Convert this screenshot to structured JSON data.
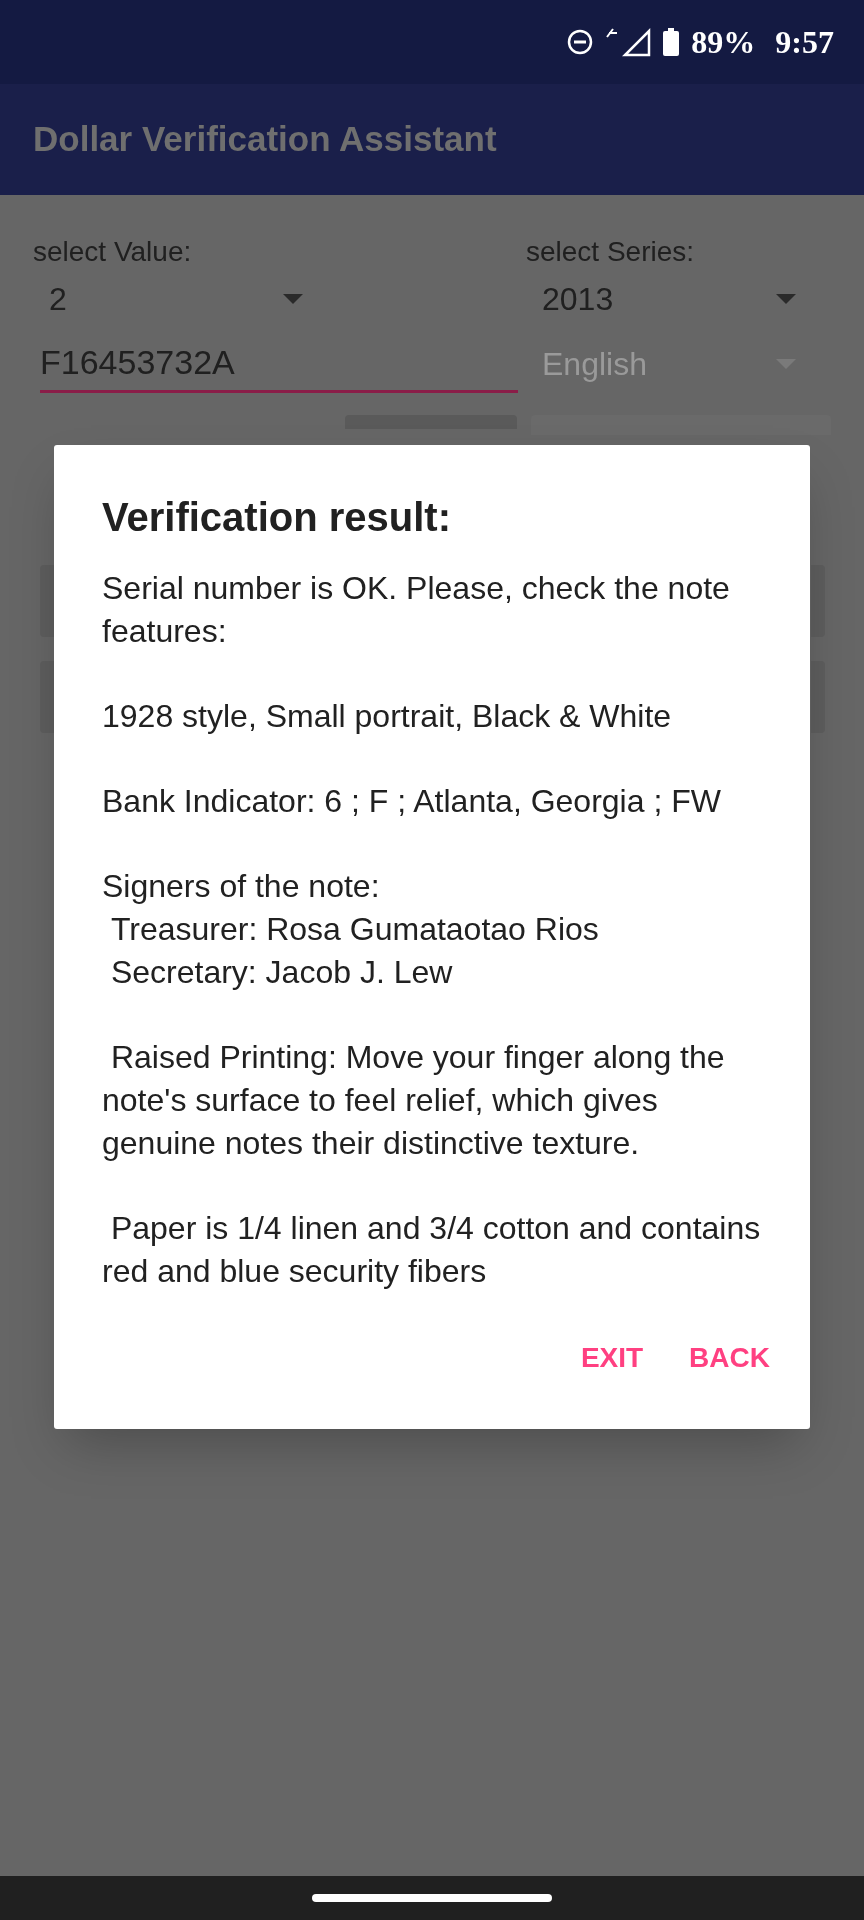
{
  "status_bar": {
    "battery": "89%",
    "time": "9:57"
  },
  "app_bar": {
    "title": "Dollar Verification Assistant"
  },
  "form": {
    "value_label": "select Value:",
    "value": "2",
    "series_label": "select Series:",
    "series": "2013",
    "serial": "F16453732A",
    "language": "English",
    "language_disabled": true
  },
  "dialog": {
    "title": "Verification result:",
    "paragraphs": [
      "Serial number is OK. Please, check the note features:",
      "1928 style, Small portrait, Black & White",
      "Bank Indicator: 6 ; F ; Atlanta, Georgia ; FW",
      "Signers of the note:\n Treasurer: Rosa Gumataotao Rios\n Secretary: Jacob J. Lew",
      " Raised Printing: Move your finger along the note's surface to feel relief, which gives genuine notes their distinctive texture.",
      " Paper is 1/4 linen and 3/4 cotton and contains red and blue security fibers"
    ],
    "buttons": [
      "EXIT",
      "BACK"
    ]
  }
}
